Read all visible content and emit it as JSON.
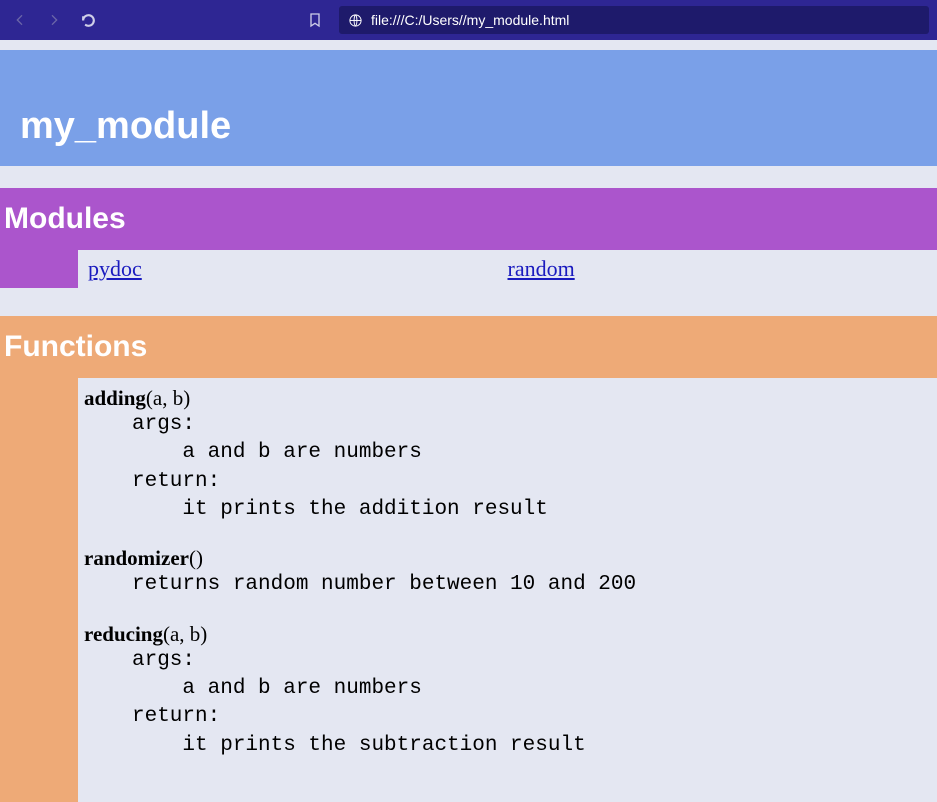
{
  "chrome": {
    "url": "file:///C:/Users//my_module.html"
  },
  "hero": {
    "title": "my_module"
  },
  "modules": {
    "header": "Modules",
    "items": [
      "pydoc",
      "random"
    ]
  },
  "functions": {
    "header": "Functions",
    "items": [
      {
        "name": "adding",
        "args": "(a, b)",
        "doc": "args:\n    a and b are numbers\nreturn:\n    it prints the addition result"
      },
      {
        "name": "randomizer",
        "args": "()",
        "doc": "returns random number between 10 and 200"
      },
      {
        "name": "reducing",
        "args": "(a, b)",
        "doc": "args:\n    a and b are numbers\nreturn:\n    it prints the subtraction result"
      }
    ]
  }
}
